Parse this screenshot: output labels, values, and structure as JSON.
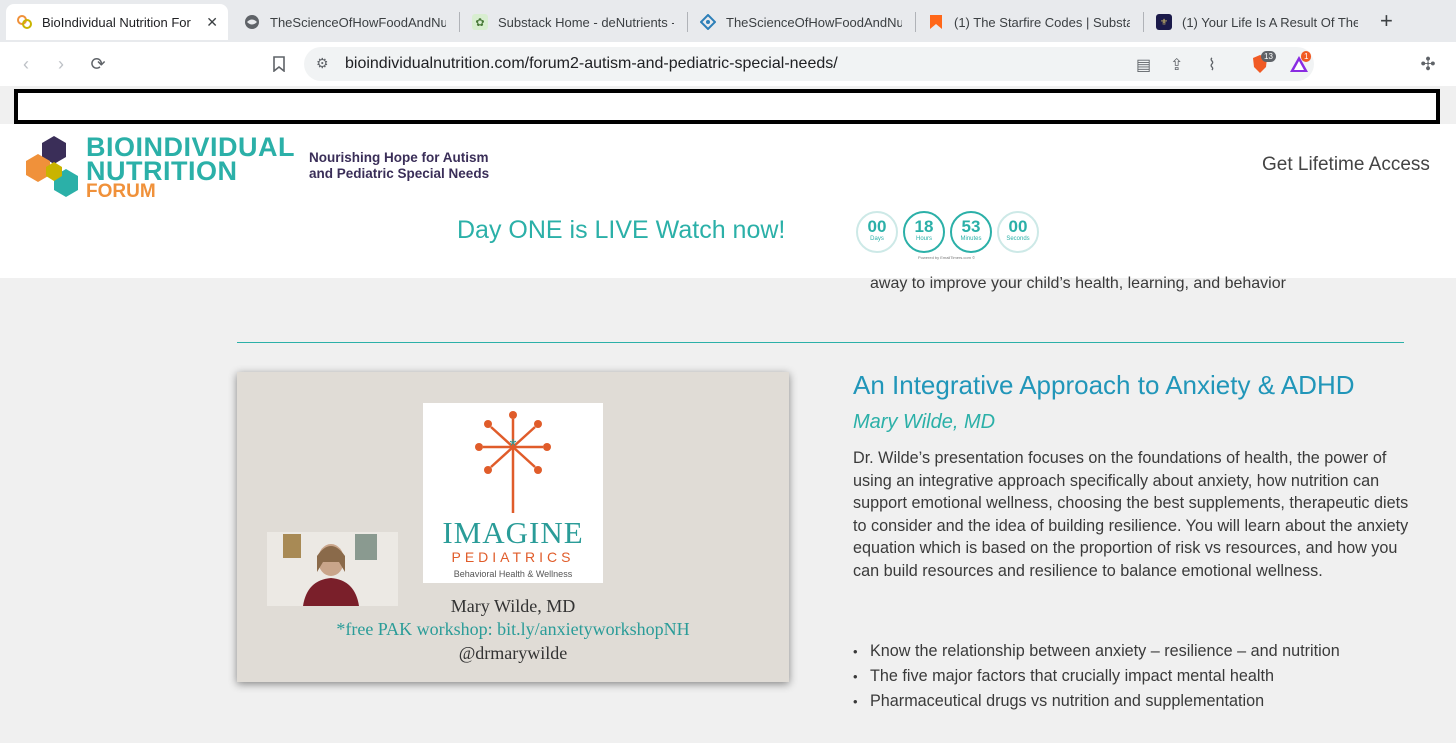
{
  "browser": {
    "tabs": [
      {
        "title": "BioIndividual Nutrition For",
        "active": true
      },
      {
        "title": "TheScienceOfHowFoodAndNut"
      },
      {
        "title": "Substack Home - deNutrients -"
      },
      {
        "title": "TheScienceOfHowFoodAndNut"
      },
      {
        "title": "(1) The Starfire Codes | Substac"
      },
      {
        "title": "(1) Your Life Is A Result Of The"
      }
    ],
    "url": "bioindividualnutrition.com/forum2-autism-and-pediatric-special-needs/",
    "brave_badge": "13",
    "ext_badge": "1"
  },
  "header": {
    "logo_line1": "BIOINDIVIDUAL",
    "logo_line2": "NUTRITION",
    "logo_line3": "FORUM",
    "tagline_line1": "Nourishing Hope for Autism",
    "tagline_line2": "and Pediatric Special Needs",
    "cta": "Get Lifetime Access",
    "live_banner": "Day ONE is LIVE Watch now!",
    "timer": [
      {
        "value": "00",
        "label": "Days"
      },
      {
        "value": "18",
        "label": "Hours"
      },
      {
        "value": "53",
        "label": "Minutes"
      },
      {
        "value": "00",
        "label": "Seconds"
      }
    ],
    "powered": "Powered by EmailTimers.com ©"
  },
  "content": {
    "prev_bullet": "away to improve your child’s health, learning, and behavior",
    "slide": {
      "logo_word": "IMAGINE",
      "logo_sub": "PEDIATRICS",
      "logo_tag": "Behavioral Health & Wellness",
      "name": "Mary Wilde, MD",
      "workshop": "*free PAK workshop: bit.ly/anxietyworkshopNH",
      "handle": "@drmarywilde"
    },
    "title": "An Integrative Approach to Anxiety & ADHD",
    "speaker": "Mary Wilde, MD",
    "description": "Dr. Wilde’s presentation focuses on the foundations of health, the power of using an integrative approach specifically about anxiety, how nutrition can support emotional wellness, choosing the best supplements, therapeutic diets to consider and the idea of building resilience. You will learn about the anxiety equation which is based on the proportion of risk vs resources, and how you can build resources and resilience to balance emotional wellness.",
    "bullets": [
      "Know the relationship between anxiety – resilience – and nutrition",
      "The five major factors that crucially impact mental health",
      "Pharmaceutical drugs vs nutrition and supplementation"
    ]
  }
}
